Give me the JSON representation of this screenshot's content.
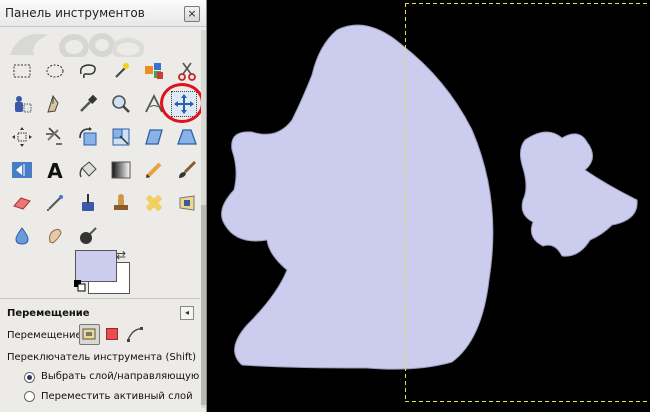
{
  "toolbox": {
    "title": "Панель инструментов",
    "close_glyph": "×",
    "tools": [
      "rect-select-icon",
      "ellipse-select-icon",
      "lasso-icon",
      "fuzzy-select-icon",
      "select-by-color-icon",
      "scissors-icon",
      "foreground-select-icon",
      "paths-icon",
      "color-picker-icon",
      "zoom-icon",
      "measure-icon",
      "move-icon",
      "align-icon",
      "crop-icon",
      "rotate-icon",
      "scale-icon",
      "shear-icon",
      "perspective-icon",
      "flip-icon",
      "text-icon",
      "bucket-fill-icon",
      "blend-icon",
      "pencil-icon",
      "paintbrush-icon",
      "eraser-icon",
      "airbrush-icon",
      "ink-icon",
      "clone-icon",
      "heal-icon",
      "perspective-clone-icon",
      "blur-icon",
      "smudge-icon",
      "dodge-burn-icon"
    ],
    "active_tool": "move-icon",
    "foreground_color": "#ccccee",
    "background_color": "#ffffff"
  },
  "tool_options": {
    "title": "Перемещение",
    "mode_label": "Перемещение:",
    "switch_label": "Переключатель инструмента  (Shift)",
    "radio_options": [
      {
        "label": "Выбрать слой/направляющую",
        "checked": true
      },
      {
        "label": "Переместить активный слой",
        "checked": false
      }
    ]
  },
  "canvas": {
    "background_color": "#000000",
    "shape_color": "#ccccee"
  }
}
